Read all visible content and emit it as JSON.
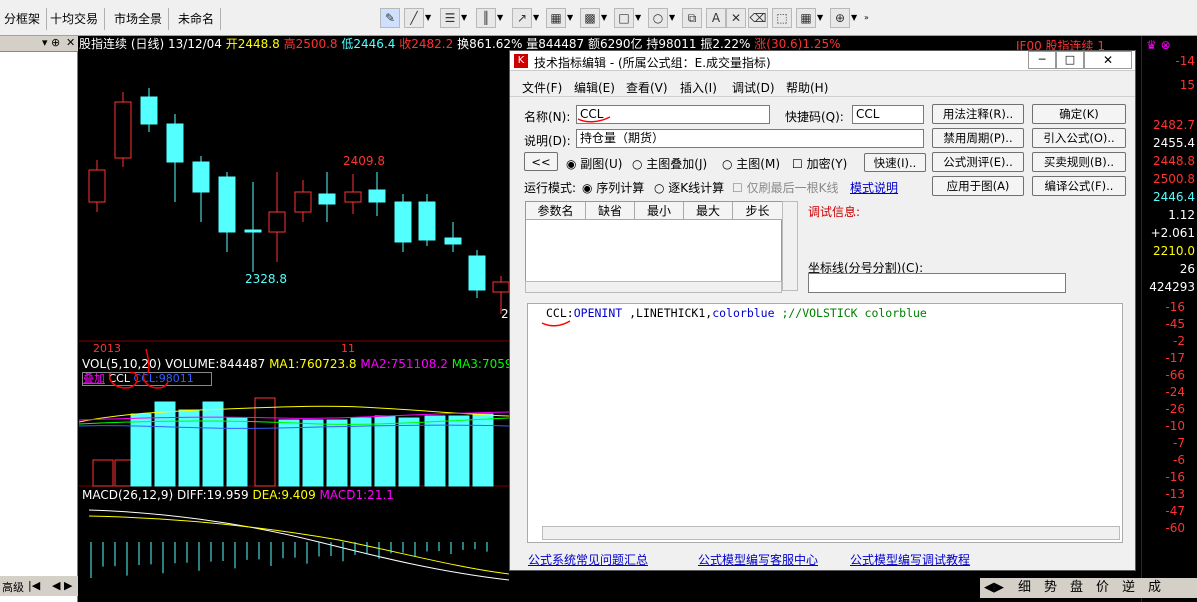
{
  "tabs": [
    "分框架",
    "十均交易",
    "市场全景",
    "未命名"
  ],
  "toolbar_icons": [
    "pen-icon",
    "line-icon",
    "table-icon",
    "columns-icon",
    "trend-icon",
    "grid-icon",
    "fibo-icon",
    "chart-icon",
    "rect-icon",
    "ellipse-icon",
    "copy-icon",
    "text-icon",
    "erase-icon",
    "tag-icon",
    "palette-icon",
    "lock-icon"
  ],
  "main_header": {
    "name": "股指连续 (日线)",
    "date": "13/12/04",
    "open": "开2448.8",
    "high": "高2500.8",
    "low": "低2446.4",
    "close": "收2482.2",
    "turnover": "换861.62%",
    "volume": "量844487",
    "amount": "额6290亿",
    "hold": "持98011",
    "amp": "振2.22%",
    "change": "涨(30.6)1.25%",
    "right_code": "IF00",
    "right_name": "股指连续",
    "right_num": "1"
  },
  "price_labels": {
    "high": "2409.8",
    "low": "2328.8",
    "partial": "2"
  },
  "axis_dates": {
    "year": "2013",
    "month": "11"
  },
  "vol_header": {
    "name": "VOL(5,10,20)",
    "volume": "VOLUME:844487",
    "ma1": "MA1:760723.8",
    "ma2": "MA2:751108.2",
    "ma3": "MA3:7059"
  },
  "overlay": {
    "add": "叠加",
    "ccl": "CCL",
    "ccl_val": "CCL:98011"
  },
  "macd_header": {
    "name": "MACD(26,12,9)",
    "diff": "DIFF:19.959",
    "dea": "DEA:9.409",
    "macd": "MACD1:21.1"
  },
  "left_bottom": "高级",
  "right_axis": {
    "top": [
      "-14",
      "15",
      "2482.7",
      "2455.4",
      "2448.8",
      "2500.8",
      "2446.4",
      "1.12",
      "+2.061",
      "2210.0",
      "26",
      "424293"
    ],
    "list": [
      "-16",
      "-45",
      "-2",
      "-17",
      "-66",
      "-24",
      "-26",
      "-10",
      "-7",
      "-6",
      "-16",
      "-13",
      "-47",
      "-60"
    ]
  },
  "bottom_strip": [
    "细",
    "势",
    "盘",
    "价",
    "逆",
    "成"
  ],
  "dialog": {
    "title": "技术指标编辑 - (所属公式组：E.成交量指标)",
    "menus": [
      "文件(F)",
      "编辑(E)",
      "查看(V)",
      "插入(I)",
      "调试(D)",
      "帮助(H)"
    ],
    "name_label": "名称(N):",
    "name_value": "CCL",
    "hotkey_label": "快捷码(Q):",
    "hotkey_value": "CCL",
    "desc_label": "说明(D):",
    "desc_value": "持仓量（期货）",
    "back_btn": "<<",
    "radio_sub": "副图(U)",
    "radio_overlay": "主图叠加(J)",
    "radio_main": "主图(M)",
    "check_encrypt": "加密(Y)",
    "quick_btn": "快速(I)..",
    "run_mode_label": "运行模式:",
    "radio_seq": "序列计算",
    "radio_step": "逐K线计算",
    "check_last": "仅刷最后一根K线",
    "mode_link": "模式说明",
    "table_headers": [
      "参数名",
      "缺省",
      "最小",
      "最大",
      "步长"
    ],
    "debug_label": "调试信息:",
    "coord_label": "坐标线(分号分割)(C):",
    "buttons": [
      "用法注释(R)..",
      "确定(K)",
      "禁用周期(P)..",
      "引入公式(O)..",
      "公式测评(E)..",
      "买卖规则(B)..",
      "应用于图(A)",
      "编译公式(F).."
    ],
    "code": {
      "name": "CCL",
      "sep": ":",
      "func": "OPENINT",
      "rest": " ,LINETHICK1,",
      "color": "colorblue",
      "comment": " ;//VOLSTICK colorblue"
    },
    "footer_links": [
      "公式系统常见问题汇总",
      "公式模型编写客服中心",
      "公式模型编写调试教程"
    ],
    "win_min": "─",
    "win_max": "□",
    "win_close": "✕"
  },
  "colors": {
    "up": "#ff3232",
    "down": "#54ffff",
    "yellow": "#ffff00",
    "magenta": "#ff00ff",
    "white": "#ffffff",
    "grid": "#800000"
  }
}
